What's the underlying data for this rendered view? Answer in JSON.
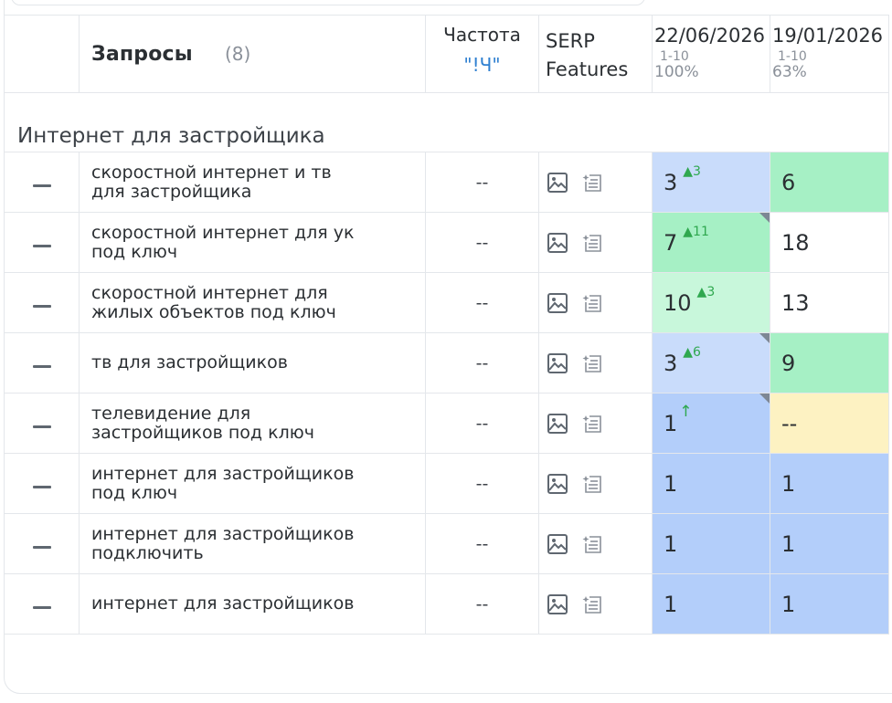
{
  "header": {
    "queries_title": "Запросы",
    "queries_count": "(8)",
    "frequency_label": "Частота",
    "frequency_sub": "\"!Ч\"",
    "serp_label_1": "SERP",
    "serp_label_2": "Features",
    "date1": {
      "date": "22/06/2026",
      "range": "1-10",
      "percent": "100%"
    },
    "date2": {
      "date": "19/01/2026",
      "range": "1-10",
      "percent": "63%"
    }
  },
  "group": {
    "name": "Интернет для застройщика"
  },
  "rows": [
    {
      "line1": "скоростной интернет и тв",
      "line2": "для застройщика",
      "freq": "--",
      "p1": {
        "value": "3",
        "delta": "▲3",
        "bg": "#c9dcfb"
      },
      "p2": {
        "value": "6",
        "bg": "#a6f0c5"
      }
    },
    {
      "line1": "скоростной интернет для ук",
      "line2": "под ключ",
      "freq": "--",
      "p1": {
        "value": "7",
        "delta": "▲11",
        "bg": "#a6f0c5"
      },
      "p2": {
        "value": "18",
        "bg": "#ffffff"
      }
    },
    {
      "line1": "скоростной интернет для",
      "line2": "жилых объектов под ключ",
      "freq": "--",
      "p1": {
        "value": "10",
        "delta": "▲3",
        "bg": "#c8f7db"
      },
      "p2": {
        "value": "13",
        "bg": "#ffffff"
      }
    },
    {
      "line1": "тв для застройщиков",
      "line2": "",
      "freq": "--",
      "p1": {
        "value": "3",
        "delta": "▲6",
        "bg": "#c9dcfb"
      },
      "p2": {
        "value": "9",
        "bg": "#a6f0c5"
      }
    },
    {
      "line1": "телевидение для",
      "line2": "застройщиков под ключ",
      "freq": "--",
      "p1": {
        "value": "1",
        "arrow": "↑",
        "bg": "#b3cefa"
      },
      "p2": {
        "value": "--",
        "bg": "#fdf2c2"
      }
    },
    {
      "line1": "интернет для застройщиков",
      "line2": "под ключ",
      "freq": "--",
      "p1": {
        "value": "1",
        "bg": "#b3cefa"
      },
      "p2": {
        "value": "1",
        "bg": "#b3cefa"
      }
    },
    {
      "line1": "интернет для застройщиков",
      "line2": "подключить",
      "freq": "--",
      "p1": {
        "value": "1",
        "bg": "#b3cefa"
      },
      "p2": {
        "value": "1",
        "bg": "#b3cefa"
      }
    },
    {
      "line1": "интернет для застройщиков",
      "line2": "",
      "freq": "--",
      "p1": {
        "value": "1",
        "bg": "#b3cefa"
      },
      "p2": {
        "value": "1",
        "bg": "#b3cefa"
      }
    }
  ],
  "icons": {
    "serp_image": "image-icon",
    "serp_snippet": "sparkle-list-icon",
    "collapse": "minus-icon"
  }
}
